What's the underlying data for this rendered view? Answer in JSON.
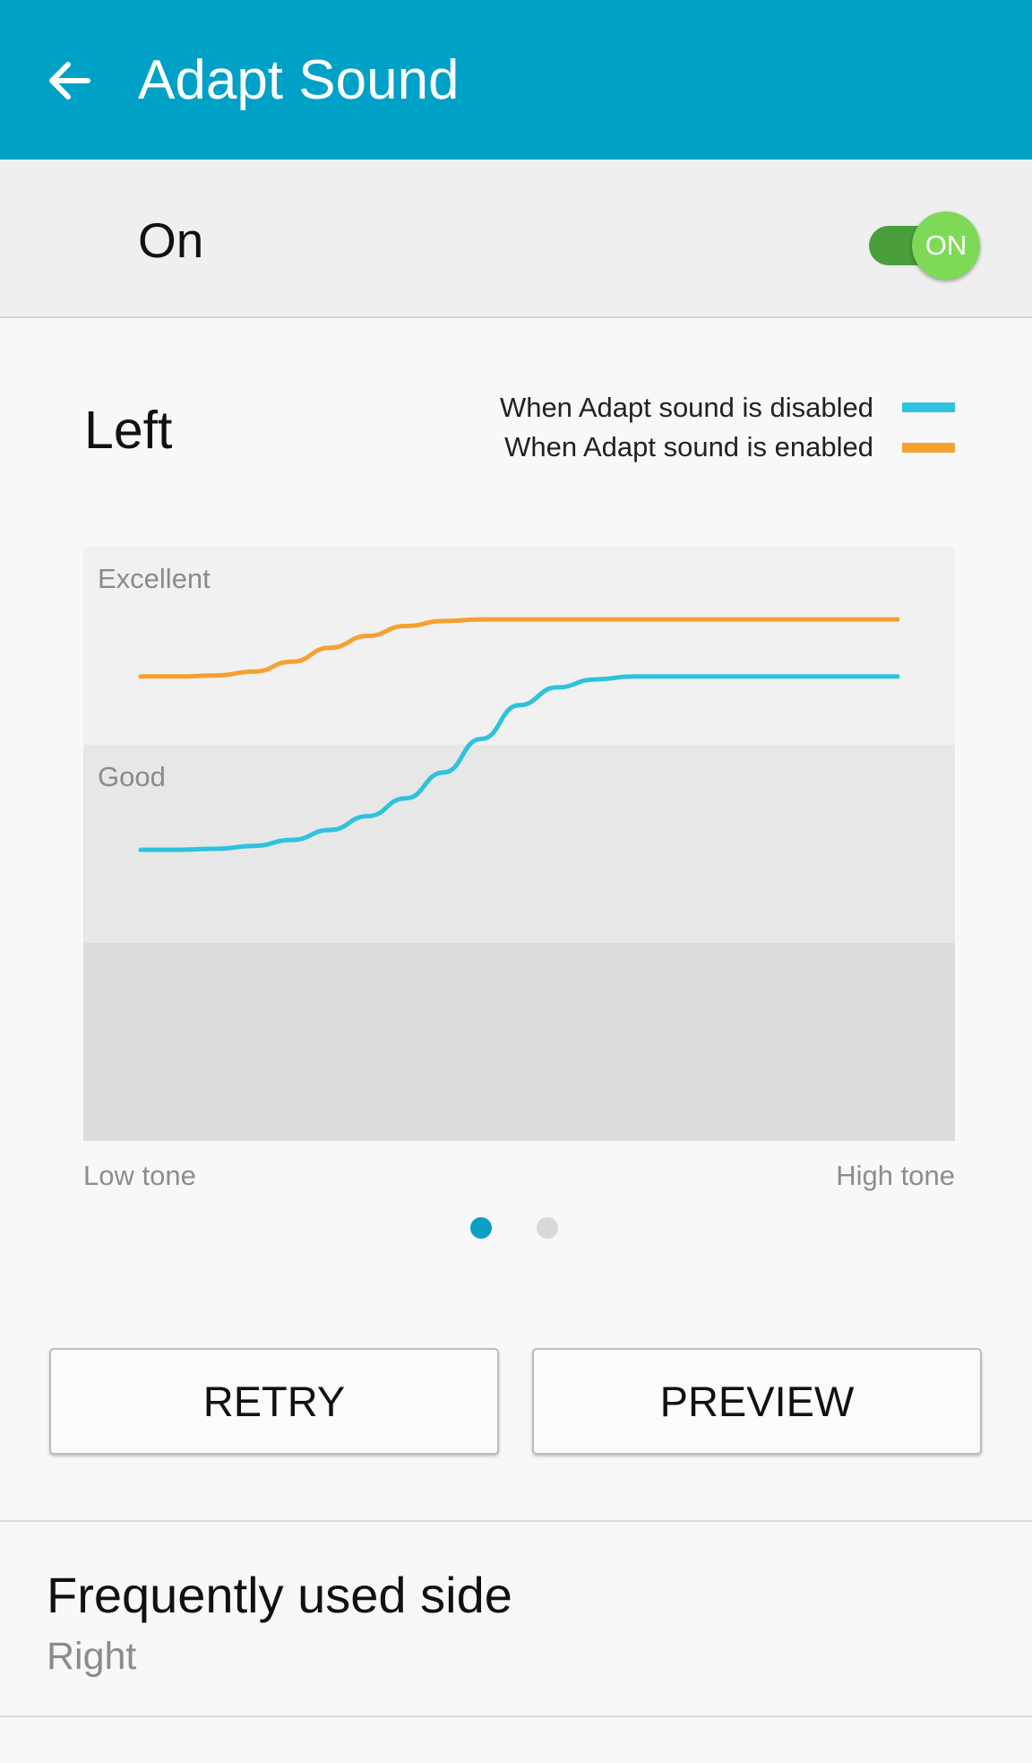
{
  "header": {
    "title": "Adapt Sound",
    "back_icon": "arrow-left-icon",
    "background": "#00a1c6"
  },
  "master_switch": {
    "label": "On",
    "toggle_text": "ON",
    "checked": true,
    "accent": "#7ed957"
  },
  "result": {
    "side": "Left",
    "legend": [
      {
        "label": "When Adapt sound is disabled",
        "color": "#2ec2dd"
      },
      {
        "label": "When Adapt sound is enabled",
        "color": "#f5a131"
      }
    ],
    "x_start_label": "Low tone",
    "x_end_label": "High tone",
    "page_indicator": {
      "count": 2,
      "current": 1,
      "active_color": "#0aa0c4",
      "inactive_color": "#d8d8d8"
    }
  },
  "chart_data": {
    "type": "line",
    "bands": [
      "Excellent",
      "Good",
      ""
    ],
    "band_colors": [
      "#f1f1f1",
      "#e7e7e7",
      "#dcdcdc"
    ],
    "x": [
      0,
      0.05,
      0.1,
      0.15,
      0.2,
      0.25,
      0.3,
      0.35,
      0.4,
      0.45,
      0.5,
      0.55,
      0.6,
      0.65,
      0.7,
      0.75,
      0.8,
      0.85,
      0.9,
      0.95,
      1.0
    ],
    "ylim": [
      0,
      3
    ],
    "series": [
      {
        "name": "When Adapt sound is disabled",
        "color": "#2ec2dd",
        "values": [
          1.47,
          1.47,
          1.475,
          1.49,
          1.52,
          1.57,
          1.64,
          1.73,
          1.86,
          2.03,
          2.2,
          2.29,
          2.33,
          2.345,
          2.345,
          2.345,
          2.345,
          2.345,
          2.345,
          2.345,
          2.345
        ]
      },
      {
        "name": "When Adapt sound is enabled",
        "color": "#f5a131",
        "values": [
          2.345,
          2.345,
          2.35,
          2.37,
          2.42,
          2.49,
          2.55,
          2.6,
          2.625,
          2.633,
          2.633,
          2.633,
          2.633,
          2.633,
          2.633,
          2.633,
          2.633,
          2.633,
          2.633,
          2.633,
          2.633
        ]
      }
    ]
  },
  "actions": {
    "retry": "RETRY",
    "preview": "PREVIEW"
  },
  "frequent_side": {
    "title": "Frequently used side",
    "value": "Right"
  }
}
